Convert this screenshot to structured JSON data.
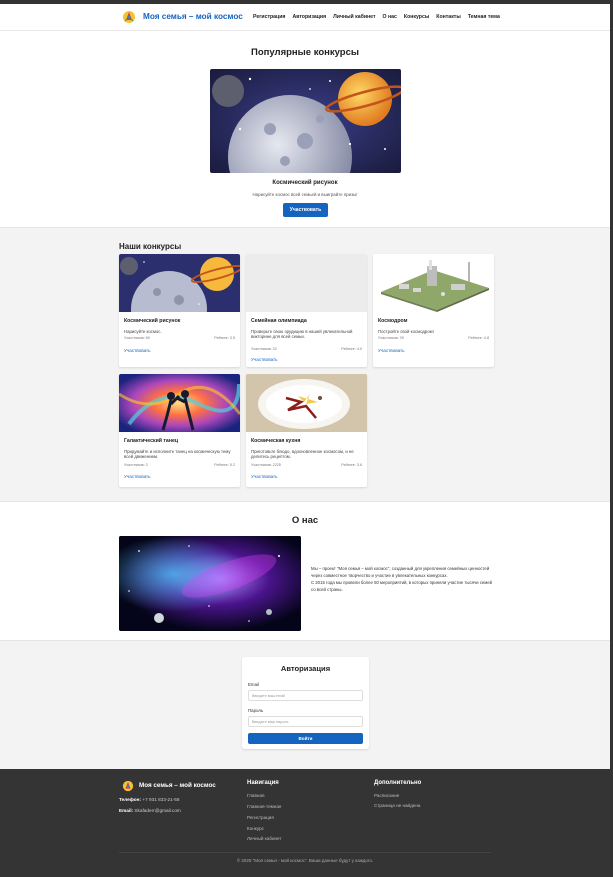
{
  "header": {
    "brand": "Моя семья – мой космос",
    "logo_icon": "rocket-logo-icon",
    "nav": [
      "Регистрация",
      "Авторизация",
      "Личный кабинет",
      "О нас",
      "Конкурсы",
      "Контакты",
      "Темная тема"
    ]
  },
  "popular": {
    "title": "Популярные конкурсы",
    "name": "Космический рисунок",
    "description": "Нарисуйте космос всей семьей и выиграйте призы!",
    "button": "Участвовать"
  },
  "contests": {
    "title": "Наши конкурсы",
    "items": [
      {
        "title": "Космический рисунок",
        "description": "Нарисуйте космос.",
        "participants": "Участников: 69",
        "rating": "Рейтинг: 3.5",
        "link": "Участвовать"
      },
      {
        "title": "Семейная олимпиада",
        "description": "Проверьте свою эрудицию в нашей увлекательной викторине для всей семьи.",
        "participants": "Участников: 32",
        "rating": "Рейтинг: 4.0",
        "link": "Участвовать"
      },
      {
        "title": "Космодром",
        "description": "Постройте свой космодром!",
        "participants": "Участников: 39",
        "rating": "Рейтинг: 4.8",
        "link": "Участвовать"
      },
      {
        "title": "Галактический танец",
        "description": "Придумайте и исполните танец на космическую тему всей движением.",
        "participants": "Участников: 3",
        "rating": "Рейтинг: 5.2",
        "link": "Участвовать"
      },
      {
        "title": "Космическая кухня",
        "description": "Приготовьте блюдо, вдохновленное космосом, и не делитесь рецептом.",
        "participants": "Участников: 2225",
        "rating": "Рейтинг: 3.6",
        "link": "Участвовать"
      }
    ]
  },
  "about": {
    "title": "О нас",
    "paragraph1": "Мы – проект \"Моя семья – мой космос\", созданный для укрепления семейных ценностей через совместное творчество и участие в увлекательных конкурсах.",
    "paragraph2": "С 2015 года мы провели более 50 мероприятий, в которых приняли участие тысячи семей со всей страны."
  },
  "auth": {
    "title": "Авторизация",
    "email_label": "Email",
    "email_placeholder": "Введите ваш email",
    "password_label": "Пароль",
    "password_placeholder": "Введите ваш пароль",
    "submit": "Войти"
  },
  "footer": {
    "brand": "Моя семья – мой космос",
    "phone_label": "Телефон:",
    "phone": "+7 931 833-21-58",
    "email_label": "Email:",
    "email": "Skafaderr@gmail.com",
    "nav_title": "Навигация",
    "nav_links": [
      "Главная",
      "Главная-темная",
      "Регистрация",
      "Конкурс",
      "Личный кабинет"
    ],
    "extra_title": "Дополнительно",
    "extra_links": [
      "Расписание",
      "Страница не найдена"
    ],
    "copyright": "© 2025 \"Моя семья - мой космос\". Ваши данные будут у каждого."
  }
}
